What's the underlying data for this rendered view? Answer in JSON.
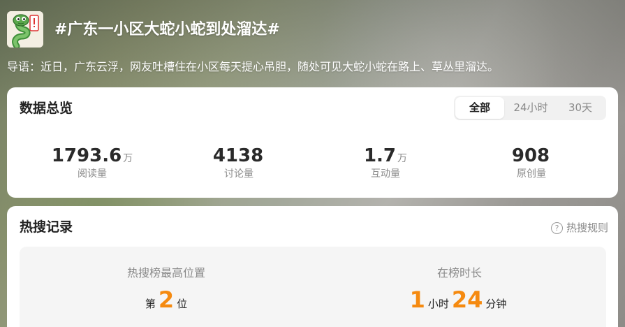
{
  "topic": {
    "title": "#广东一小区大蛇小蛇到处溜达#",
    "intro": "导语：近日，广东云浮，网友吐槽住在小区每天提心吊胆，随处可见大蛇小蛇在路上、草丛里溜达。"
  },
  "data_overview": {
    "title": "数据总览",
    "tabs": [
      {
        "label": "全部",
        "active": true
      },
      {
        "label": "24小时",
        "active": false
      },
      {
        "label": "30天",
        "active": false
      }
    ],
    "stats": [
      {
        "value": "1793.6",
        "unit": "万",
        "label": "阅读量"
      },
      {
        "value": "4138",
        "unit": "",
        "label": "讨论量"
      },
      {
        "value": "1.7",
        "unit": "万",
        "label": "互动量"
      },
      {
        "value": "908",
        "unit": "",
        "label": "原创量"
      }
    ]
  },
  "hot_search": {
    "title": "热搜记录",
    "rules_label": "热搜规则",
    "rules_icon": "?",
    "highest_position": {
      "label": "热搜榜最高位置",
      "prefix": "第",
      "value": "2",
      "suffix": "位"
    },
    "duration": {
      "label": "在榜时长",
      "hours": "1",
      "hours_unit": "小时",
      "minutes": "24",
      "minutes_unit": "分钟"
    }
  },
  "colors": {
    "accent_orange": "#f58a10",
    "text_dark": "#222222",
    "text_muted": "#8a8a8a",
    "card_bg": "#ffffff"
  }
}
